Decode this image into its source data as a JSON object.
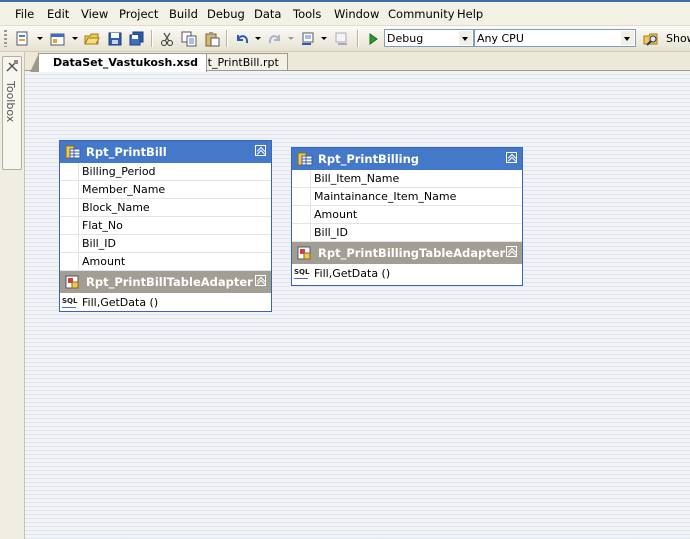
{
  "menu": [
    "File",
    "Edit",
    "View",
    "Project",
    "Build",
    "Debug",
    "Data",
    "Tools",
    "Window",
    "Community",
    "Help"
  ],
  "toolbar": {
    "config_value": "Debug",
    "platform_value": "Any CPU",
    "show_label": "Show"
  },
  "toolbox": {
    "label": "Toolbox"
  },
  "tabs": [
    {
      "label": "DataSet_Vastukosh.xsd",
      "active": true
    },
    {
      "label": "Rpt_PrintBill.rpt",
      "active": false
    }
  ],
  "tables": [
    {
      "name": "Rpt_PrintBill",
      "columns": [
        "Billing_Period",
        "Member_Name",
        "Block_Name",
        "Flat_No",
        "Bill_ID",
        "Amount"
      ],
      "adapter": "Rpt_PrintBillTableAdapter",
      "query": "Fill,GetData ()"
    },
    {
      "name": "Rpt_PrintBilling",
      "columns": [
        "Bill_Item_Name",
        "Maintainance_Item_Name",
        "Amount",
        "Bill_ID"
      ],
      "adapter": "Rpt_PrintBillingTableAdapter",
      "query": "Fill,GetData ()"
    }
  ],
  "colors": {
    "table_header": "#4478c8",
    "adapter_header": "#a39e94",
    "table_border": "#3c64b4"
  }
}
